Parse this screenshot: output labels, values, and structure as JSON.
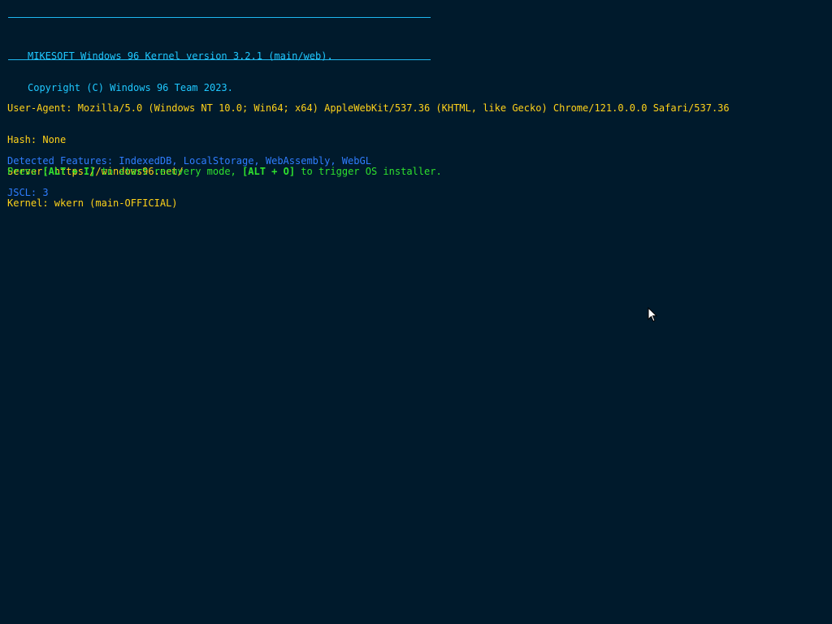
{
  "banner": {
    "line1": "MIKESOFT Windows 96 Kernel version 3.2.1 (main/web).",
    "line2": "Copyright (C) Windows 96 Team 2023."
  },
  "info": {
    "user_agent": "User-Agent: Mozilla/5.0 (Windows NT 10.0; Win64; x64) AppleWebKit/537.36 (KHTML, like Gecko) Chrome/121.0.0.0 Safari/537.36",
    "hash": "Hash: None",
    "server": "Server: https://windows96.net/",
    "kernel": "Kernel: wkern (main-OFFICIAL)"
  },
  "features": {
    "detected": "Detected Features: IndexedDB, LocalStorage, WebAssembly, WebGL",
    "jscl": "JSCL: 3"
  },
  "prompt": {
    "press": "Press ",
    "key_recovery": "[ALT + I]",
    "recovery_text": " to start recovery mode, ",
    "key_installer": "[ALT + O]",
    "installer_text": " to trigger OS installer."
  },
  "colors": {
    "background": "#001a2c",
    "banner": "#1fc8ff",
    "info": "#ffd21a",
    "features": "#2f7dff",
    "prompt": "#2ee02e"
  },
  "icons": {
    "cursor": "mouse-pointer-icon"
  }
}
